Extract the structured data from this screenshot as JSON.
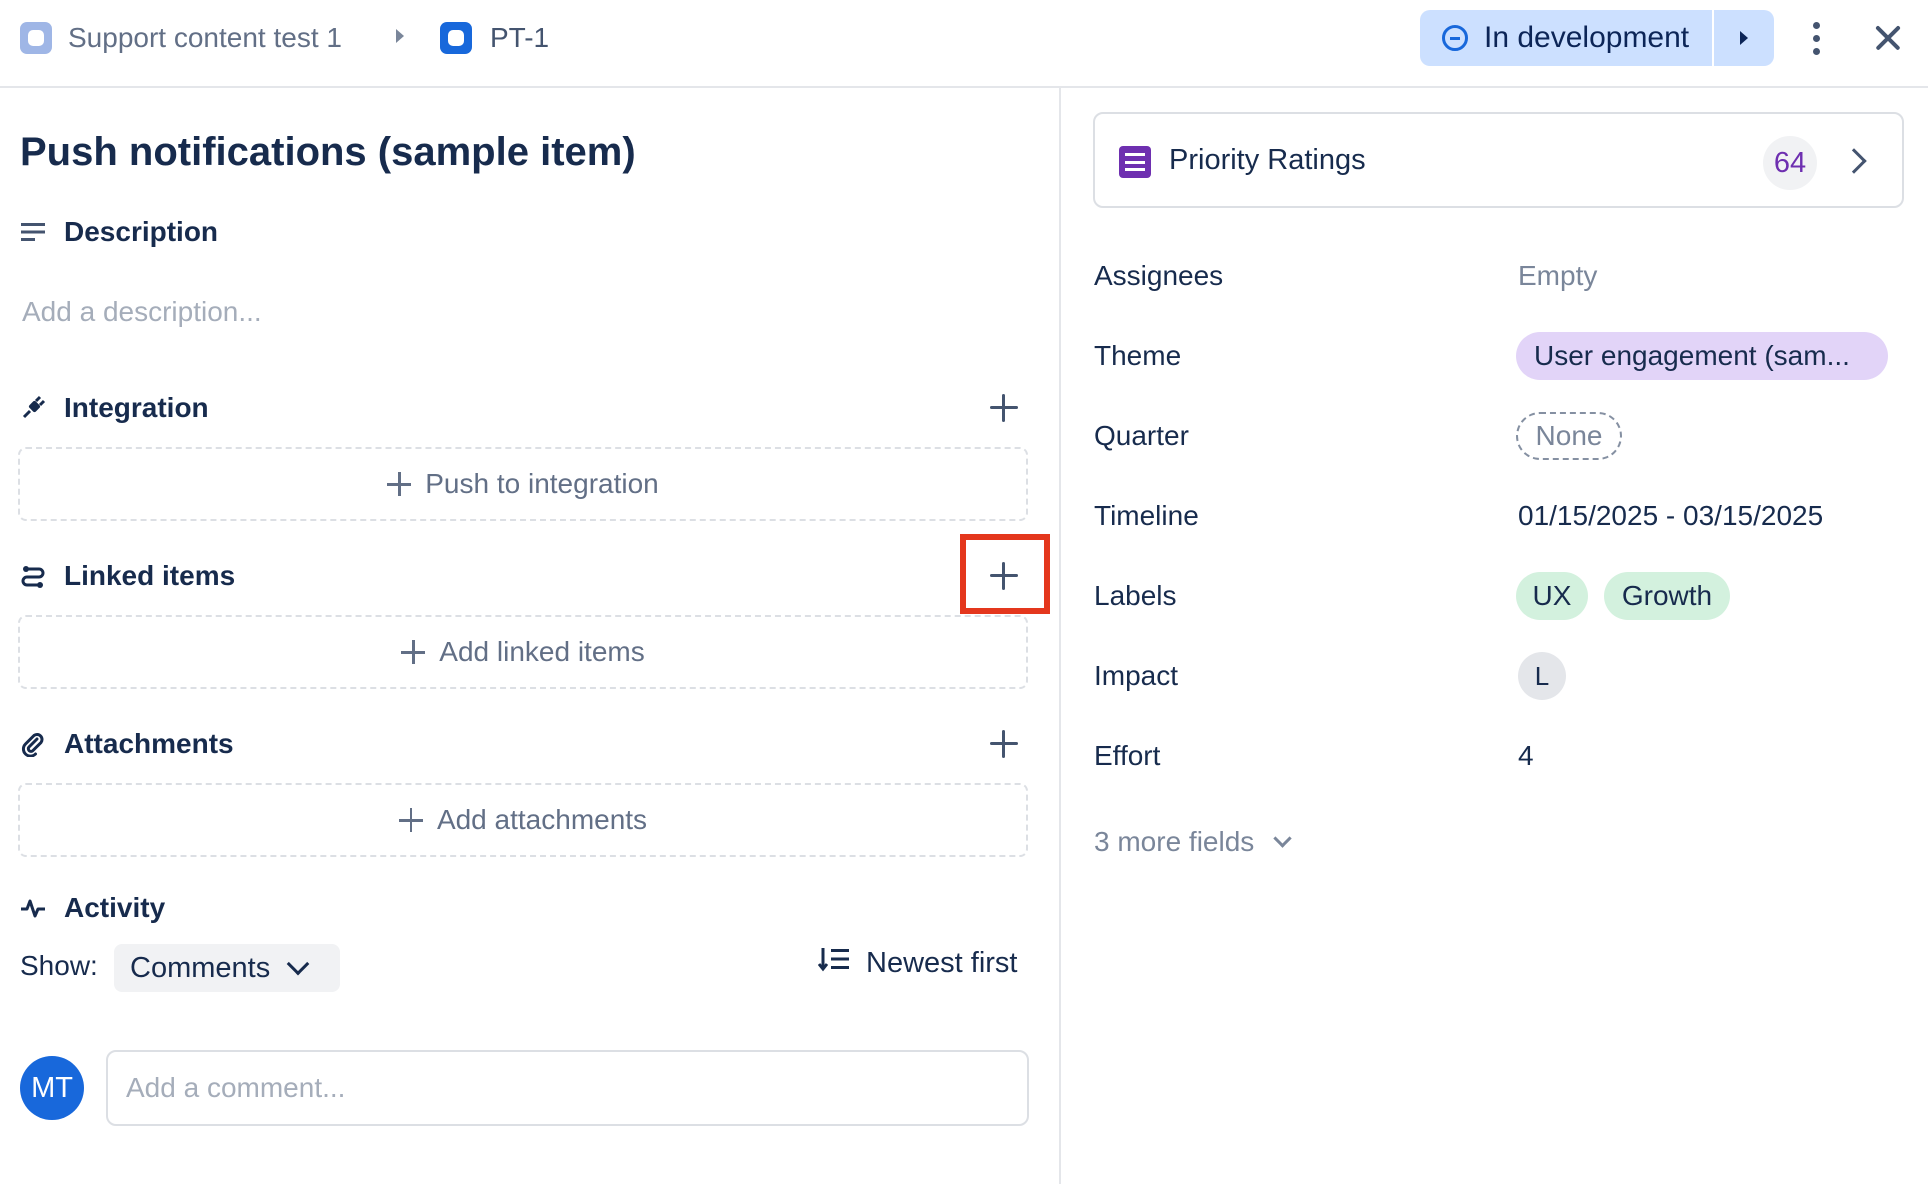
{
  "header": {
    "breadcrumb_project": "Support content test 1",
    "breadcrumb_item": "PT-1",
    "status_label": "In development"
  },
  "item": {
    "title": "Push notifications (sample item)",
    "description_heading": "Description",
    "description_placeholder": "Add a description...",
    "integration_heading": "Integration",
    "push_to_integration": "Push to integration",
    "linked_items_heading": "Linked items",
    "add_linked_items": "Add linked items",
    "attachments_heading": "Attachments",
    "add_attachments": "Add attachments",
    "activity_heading": "Activity"
  },
  "activity": {
    "show_label": "Show:",
    "show_value": "Comments",
    "sort_label": "Newest first",
    "avatar_initials": "MT",
    "comment_placeholder": "Add a comment..."
  },
  "priority": {
    "label": "Priority Ratings",
    "count": "64"
  },
  "fields": {
    "assignees_label": "Assignees",
    "assignees_value": "Empty",
    "theme_label": "Theme",
    "theme_value": "User engagement (sam...",
    "quarter_label": "Quarter",
    "quarter_value": "None",
    "timeline_label": "Timeline",
    "timeline_value": "01/15/2025 - 03/15/2025",
    "labels_label": "Labels",
    "labels": [
      "UX",
      "Growth"
    ],
    "impact_label": "Impact",
    "impact_value": "L",
    "effort_label": "Effort",
    "effort_value": "4",
    "more_fields": "3 more fields"
  },
  "colors": {
    "status_bg": "#cce0ff",
    "accent_blue": "#1868db",
    "priority_purple": "#6e2fb0",
    "theme_pill": "#e2d4f8",
    "label_pill": "#d3f1de",
    "highlight_red": "#e4371d"
  }
}
